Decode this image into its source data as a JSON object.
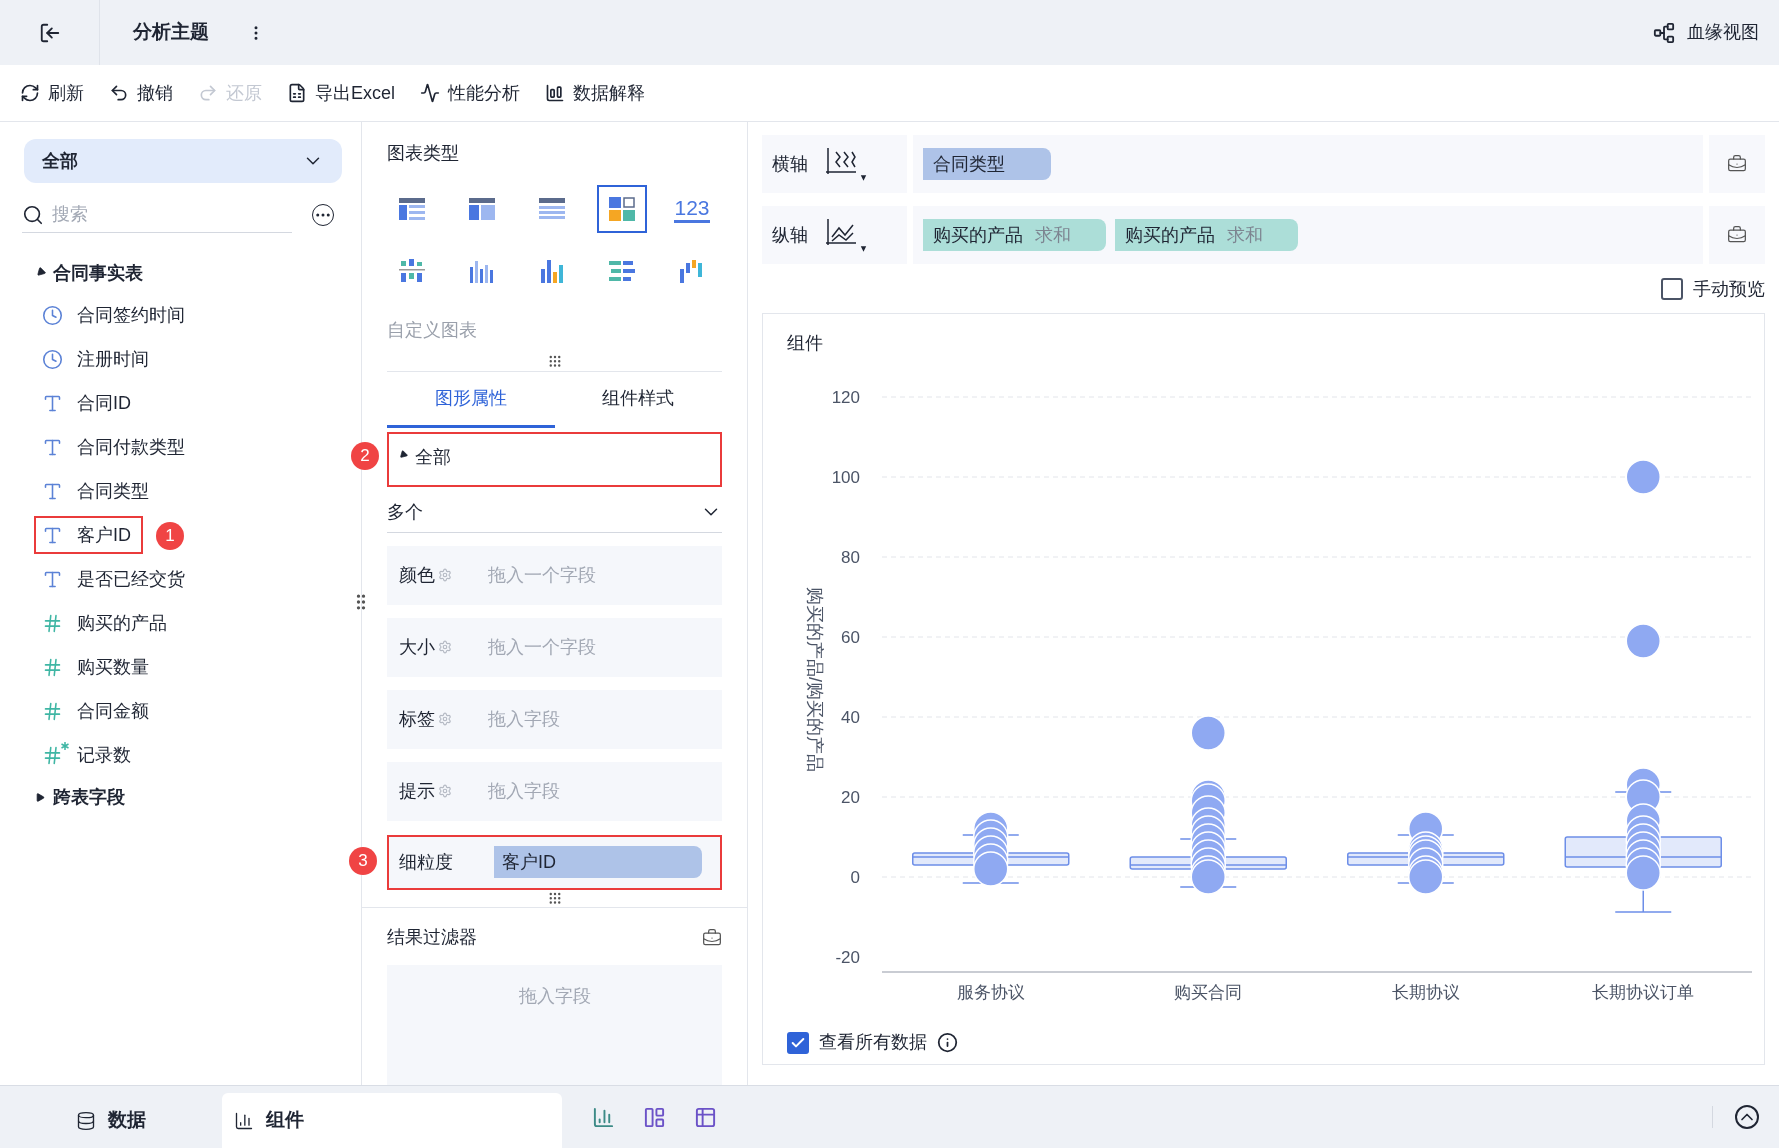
{
  "header": {
    "title": "分析主题",
    "lineage": "血缘视图"
  },
  "toolbar": [
    {
      "label": "刷新",
      "kind": "refresh",
      "disabled": false
    },
    {
      "label": "撤销",
      "kind": "undo",
      "disabled": false
    },
    {
      "label": "还原",
      "kind": "redo",
      "disabled": true
    },
    {
      "label": "导出Excel",
      "kind": "excel",
      "disabled": false
    },
    {
      "label": "性能分析",
      "kind": "performance",
      "disabled": false
    },
    {
      "label": "数据解释",
      "kind": "explain",
      "disabled": false
    }
  ],
  "sidebar": {
    "dropdown": "全部",
    "search": {
      "placeholder": "搜索"
    },
    "tree": [
      {
        "label": "合同事实表",
        "expanded": true,
        "children": [
          {
            "label": "合同签约时间",
            "kind": "time"
          },
          {
            "label": "注册时间",
            "kind": "time"
          },
          {
            "label": "合同ID",
            "kind": "text"
          },
          {
            "label": "合同付款类型",
            "kind": "text"
          },
          {
            "label": "合同类型",
            "kind": "text"
          },
          {
            "label": "客户ID",
            "kind": "text",
            "callout": "1"
          },
          {
            "label": "是否已经交货",
            "kind": "text"
          },
          {
            "label": "购买的产品",
            "kind": "number"
          },
          {
            "label": "购买数量",
            "kind": "number"
          },
          {
            "label": "合同金额",
            "kind": "number"
          },
          {
            "label": "记录数",
            "kind": "calc"
          }
        ]
      },
      {
        "label": "跨表字段",
        "expanded": false
      }
    ]
  },
  "middle": {
    "chart_types_title": "图表类型",
    "chart_types": [
      {
        "kind": "table",
        "selected": false
      },
      {
        "kind": "crosstable",
        "selected": false
      },
      {
        "kind": "detail",
        "selected": false
      },
      {
        "kind": "custom",
        "selected": true
      },
      {
        "kind": "number",
        "label": "123",
        "selected": false
      },
      {
        "kind": "dot",
        "selected": false
      },
      {
        "kind": "grouped",
        "selected": false
      },
      {
        "kind": "bar",
        "selected": false
      },
      {
        "kind": "hbar",
        "selected": false
      },
      {
        "kind": "waterfall",
        "selected": false
      }
    ],
    "custom_chart": "自定义图表",
    "tabs": [
      {
        "label": "图形属性",
        "selected": true
      },
      {
        "label": "组件样式",
        "selected": false
      }
    ],
    "section": {
      "label": "全部",
      "expanded": true,
      "callout": "2"
    },
    "mark_type": "多个",
    "slots": [
      {
        "label": "颜色",
        "hint": "拖入一个字段"
      },
      {
        "label": "大小",
        "hint": "拖入一个字段"
      },
      {
        "label": "标签",
        "hint": "拖入字段"
      },
      {
        "label": "提示",
        "hint": "拖入字段"
      }
    ],
    "granularity": {
      "label": "细粒度",
      "value": "客户ID",
      "callout": "3"
    },
    "filter": {
      "title": "结果过滤器",
      "hint": "拖入字段"
    }
  },
  "axes": [
    {
      "label": "横轴",
      "kind": "x",
      "fields": [
        {
          "name": "合同类型",
          "kind": "dimension"
        }
      ]
    },
    {
      "label": "纵轴",
      "kind": "y",
      "fields": [
        {
          "name": "购买的产品",
          "agg": "求和",
          "kind": "measure"
        },
        {
          "name": "购买的产品",
          "agg": "求和",
          "kind": "measure"
        }
      ]
    }
  ],
  "manual_preview": {
    "label": "手动预览",
    "checked": false
  },
  "component": {
    "title": "组件",
    "plot": {
      "ylabel": "购买的产品/购买的产品",
      "yticks": [
        "120",
        "100",
        "80",
        "60",
        "40",
        "20",
        "0",
        "-20"
      ],
      "categories": [
        "服务协议",
        "购买合同",
        "长期协议",
        "长期协议订单"
      ]
    },
    "view_all": {
      "label": "查看所有数据",
      "checked": true
    }
  },
  "bottom": {
    "tabs": [
      {
        "label": "数据",
        "kind": "data",
        "selected": false
      },
      {
        "label": "组件",
        "kind": "component",
        "selected": true
      }
    ]
  }
}
